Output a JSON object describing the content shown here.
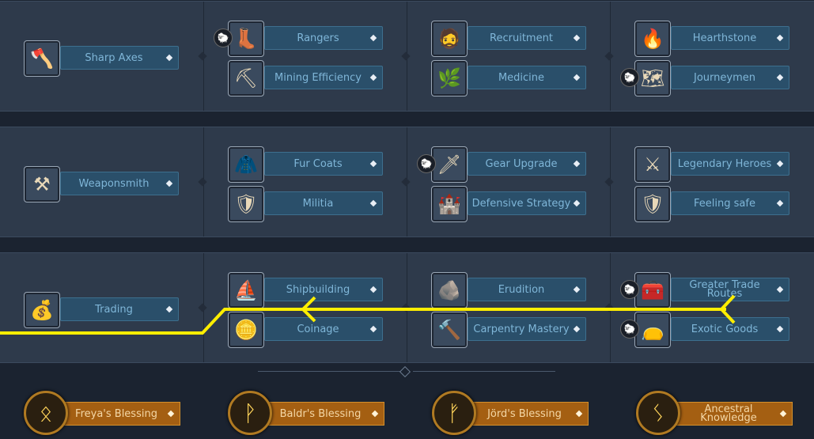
{
  "rows": [
    {
      "columns": [
        {
          "nodes": [
            {
              "label": "Sharp Axes",
              "icon": "axe-icon",
              "glyph": "🪓",
              "req": false
            }
          ]
        },
        {
          "nodes": [
            {
              "label": "Rangers",
              "icon": "boot-icon",
              "glyph": "👢",
              "req": true
            },
            {
              "label": "Mining Efficiency",
              "icon": "pickaxe-icon",
              "glyph": "⛏",
              "req": false
            }
          ]
        },
        {
          "nodes": [
            {
              "label": "Recruitment",
              "icon": "viking-face-icon",
              "glyph": "🧔",
              "req": false
            },
            {
              "label": "Medicine",
              "icon": "herb-icon",
              "glyph": "🌿",
              "req": false
            }
          ]
        },
        {
          "nodes": [
            {
              "label": "Hearthstone",
              "icon": "fire-icon",
              "glyph": "🔥",
              "req": false
            },
            {
              "label": "Journeymen",
              "icon": "map-icon",
              "glyph": "🗺",
              "req": true
            }
          ]
        }
      ]
    },
    {
      "columns": [
        {
          "nodes": [
            {
              "label": "Weaponsmith",
              "icon": "anvil-icon",
              "glyph": "⚒",
              "req": false
            }
          ]
        },
        {
          "nodes": [
            {
              "label": "Fur Coats",
              "icon": "fur-icon",
              "glyph": "🧥",
              "req": false
            },
            {
              "label": "Militia",
              "icon": "round-shield-icon",
              "glyph": "🛡",
              "req": false
            }
          ]
        },
        {
          "nodes": [
            {
              "label": "Gear Upgrade",
              "icon": "sword-icon",
              "glyph": "🗡",
              "req": true
            },
            {
              "label": "Defensive Strategy",
              "icon": "tower-icon",
              "glyph": "🏰",
              "req": false
            }
          ]
        },
        {
          "nodes": [
            {
              "label": "Legendary Heroes",
              "icon": "battle-axe-icon",
              "glyph": "⚔",
              "req": false
            },
            {
              "label": "Feeling safe",
              "icon": "crest-shield-icon",
              "glyph": "🛡",
              "req": false
            }
          ]
        }
      ]
    },
    {
      "columns": [
        {
          "nodes": [
            {
              "label": "Trading",
              "icon": "coins-icon",
              "glyph": "💰",
              "req": false
            }
          ]
        },
        {
          "nodes": [
            {
              "label": "Shipbuilding",
              "icon": "longship-icon",
              "glyph": "⛵",
              "req": false
            },
            {
              "label": "Coinage",
              "icon": "coin-icon",
              "glyph": "🪙",
              "req": false
            }
          ]
        },
        {
          "nodes": [
            {
              "label": "Erudition",
              "icon": "runestone-icon",
              "glyph": "🪨",
              "req": false
            },
            {
              "label": "Carpentry Mastery",
              "icon": "hammer-icon",
              "glyph": "🔨",
              "req": false
            }
          ]
        },
        {
          "nodes": [
            {
              "label": "Greater Trade Routes",
              "icon": "chest-icon",
              "glyph": "🧰",
              "req": true
            },
            {
              "label": "Exotic Goods",
              "icon": "sack-icon",
              "glyph": "👝",
              "req": true
            }
          ]
        }
      ]
    }
  ],
  "blessings": [
    {
      "label": "Freya's Blessing",
      "rune": "ᛟ"
    },
    {
      "label": "Baldr's Blessing",
      "rune": "ᚹ"
    },
    {
      "label": "Jörd's Blessing",
      "rune": "ᚠ"
    },
    {
      "label": "Ancestral Knowledge",
      "rune": "ᛊ"
    }
  ],
  "req_glyph": "🐑",
  "colors": {
    "accent_path": "#ffee00",
    "blue_label": "#2a4f6a",
    "gold_label": "#a45f12"
  }
}
